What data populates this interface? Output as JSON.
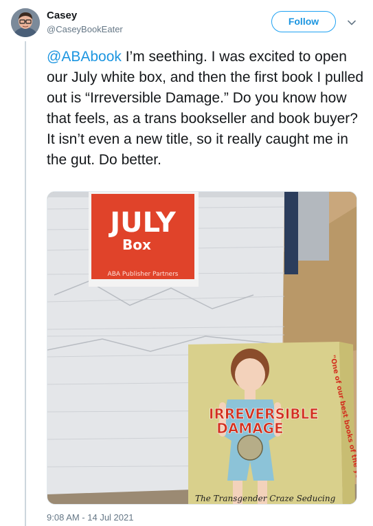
{
  "author": {
    "display_name": "Casey",
    "handle": "@CaseyBookEater"
  },
  "follow_label": "Follow",
  "tweet": {
    "mention": "@ABAbook",
    "text": " I’m seething. I was excited to open our July white box, and then the first book I pulled out is “Irreversible Damage.” Do you know how that feels, as a trans bookseller and book buyer? It isn’t even a new title, so it really caught me in the gut. Do better.",
    "timestamp": "9:08 AM - 14 Jul 2021"
  },
  "photo": {
    "box_label_line1": "JULY",
    "box_label_line2": "Box",
    "box_label_line3": "ABA Publisher Partners",
    "book_title_line1": "IRREVERSIBLE",
    "book_title_line2": "DAMAGE",
    "book_subtitle": "The Transgender Craze Seducing",
    "book_spine_quote": "\"One of our best books of the year\" —"
  },
  "colors": {
    "accent": "#1da1f2",
    "link": "#1b95e0",
    "secondary_text": "#657786",
    "box_label_red": "#e0432a",
    "book_cover": "#d9d08c",
    "book_title_red": "#d2301f"
  },
  "icons": {
    "chevron": "chevron-down-icon",
    "avatar": "avatar"
  }
}
